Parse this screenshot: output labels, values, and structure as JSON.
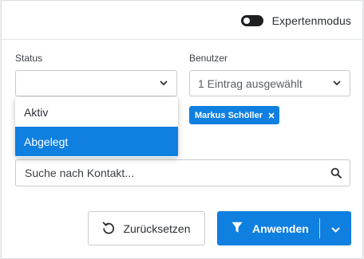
{
  "header": {
    "expert_mode_label": "Expertenmodus"
  },
  "status": {
    "label": "Status",
    "value": "",
    "options": [
      {
        "label": "Aktiv"
      },
      {
        "label": "Abgelegt"
      }
    ]
  },
  "user": {
    "label": "Benutzer",
    "value": "1 Eintrag ausgewählt",
    "selected_chip": "Markus Schöller"
  },
  "search": {
    "placeholder": "Suche nach Kontakt..."
  },
  "actions": {
    "reset_label": "Zurücksetzen",
    "apply_label": "Anwenden"
  },
  "colors": {
    "accent": "#0f7fe0",
    "toggle": "#1e1f21"
  }
}
